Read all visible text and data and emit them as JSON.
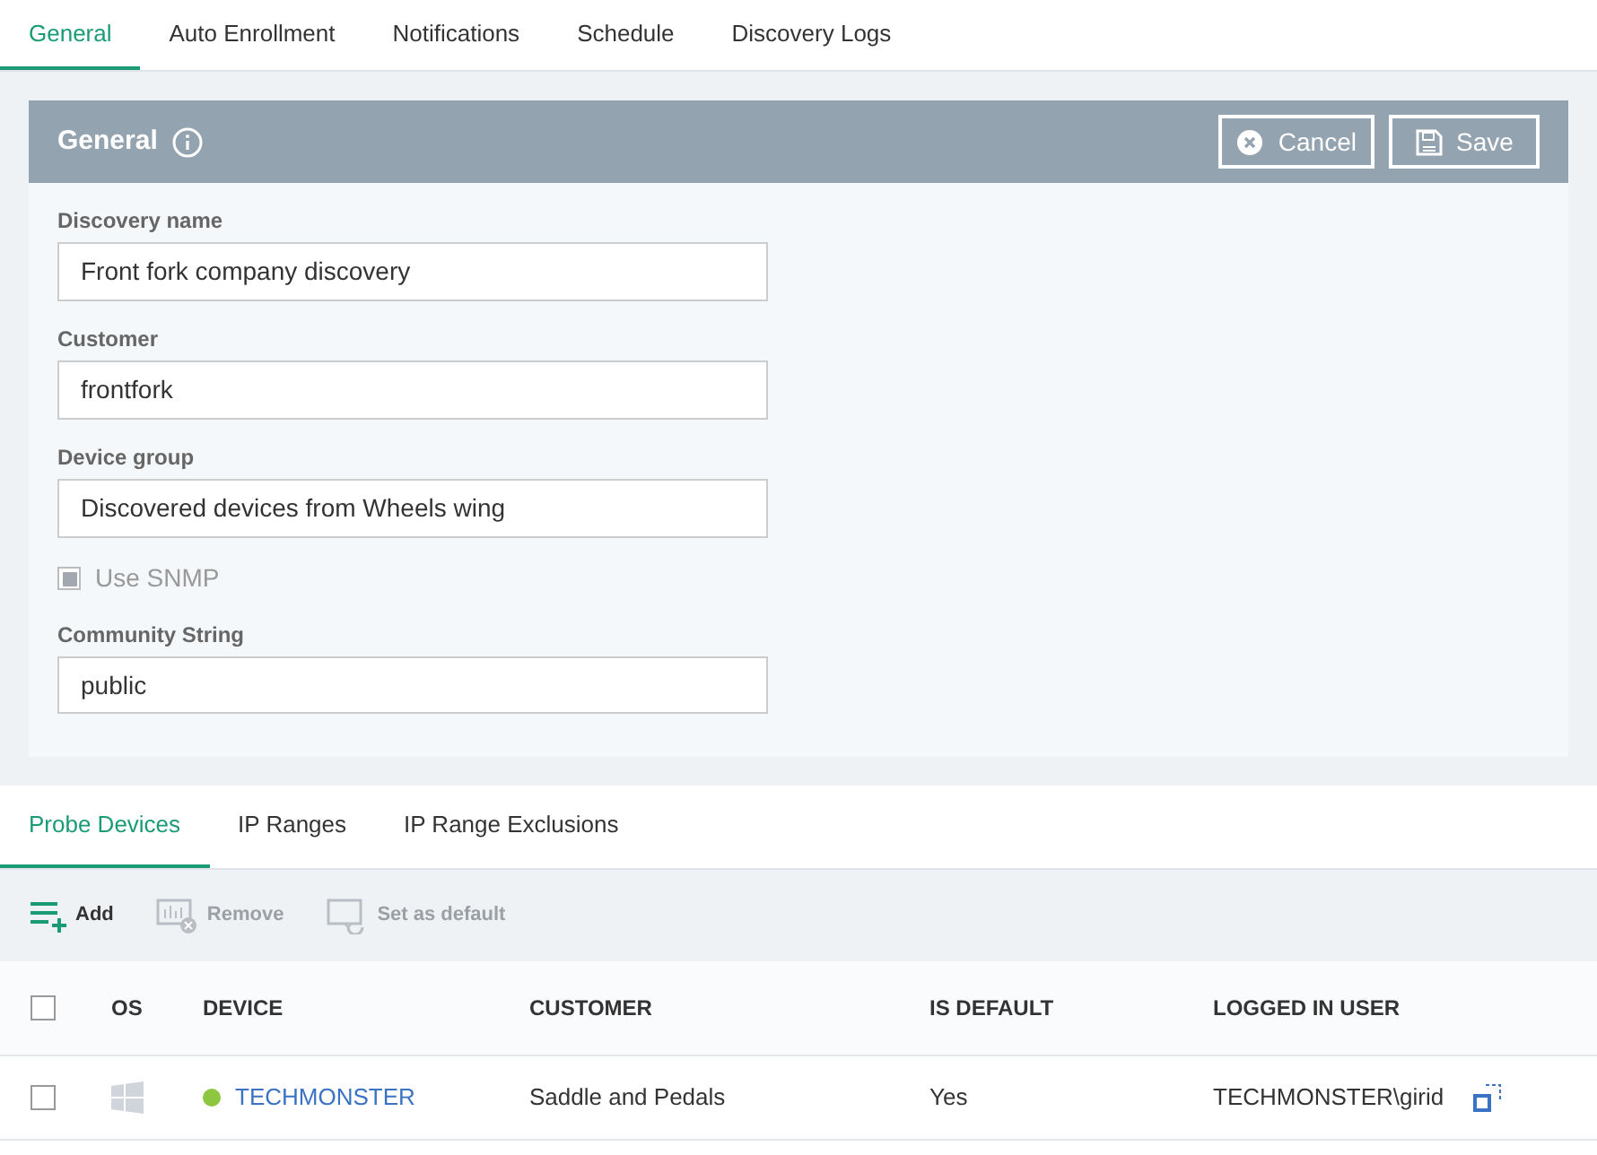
{
  "tabs": [
    {
      "label": "General",
      "selected": true
    },
    {
      "label": "Auto Enrollment",
      "selected": false
    },
    {
      "label": "Notifications",
      "selected": false
    },
    {
      "label": "Schedule",
      "selected": false
    },
    {
      "label": "Discovery Logs",
      "selected": false
    }
  ],
  "panel": {
    "title": "General",
    "buttons": [
      {
        "kind": "cancel",
        "label": "Cancel"
      },
      {
        "kind": "save",
        "label": "Save"
      }
    ]
  },
  "fields": [
    {
      "label": "Discovery name",
      "value": "Front fork company discovery"
    },
    {
      "label": "Customer",
      "value": "frontfork"
    },
    {
      "label": "Device group",
      "value": "Discovered devices from Wheels wing"
    }
  ],
  "snmp": {
    "label": "Use SNMP",
    "checked": true,
    "disabled": true
  },
  "community": {
    "label": "Community String",
    "value": "public"
  },
  "sub_tabs": [
    {
      "label": "Probe Devices",
      "selected": true
    },
    {
      "label": "IP Ranges",
      "selected": false
    },
    {
      "label": "IP Range Exclusions",
      "selected": false
    }
  ],
  "toolbar": [
    {
      "kind": "add",
      "label": "Add",
      "disabled": false
    },
    {
      "kind": "remove",
      "label": "Remove",
      "disabled": true
    },
    {
      "kind": "default",
      "label": "Set as default",
      "disabled": true
    }
  ],
  "table": {
    "select_all_checked": false,
    "columns": [
      "OS",
      "DEVICE",
      "CUSTOMER",
      "IS DEFAULT",
      "LOGGED IN USER"
    ],
    "rows": [
      {
        "checked": false,
        "color": "#8dc63f",
        "device": "TECHMONSTER",
        "customer": "Saddle and Pedals",
        "is_default": "Yes",
        "logged_in_user": "TECHMONSTER\\girid"
      }
    ]
  }
}
